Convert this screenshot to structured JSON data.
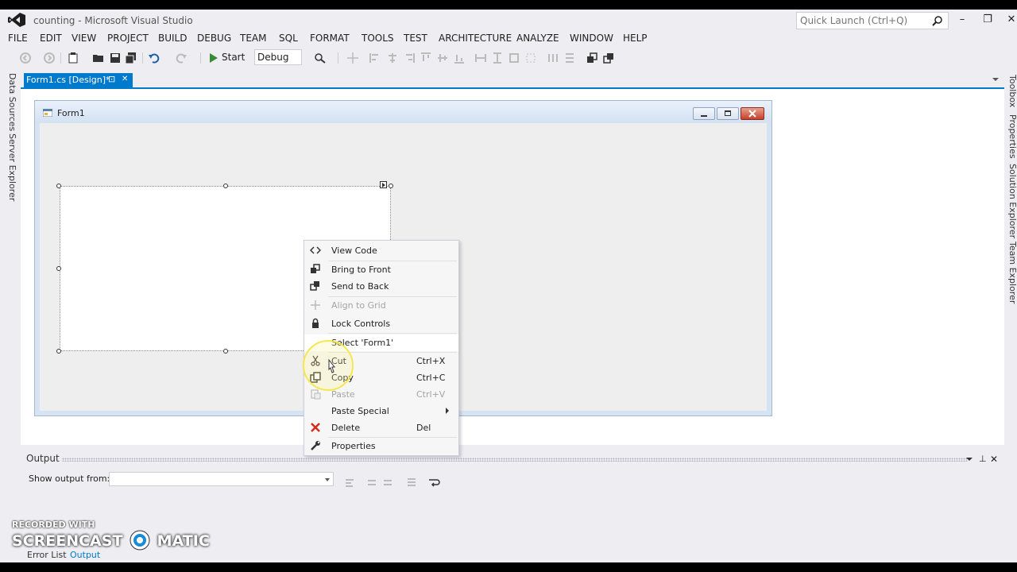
{
  "window": {
    "title": "counting - Microsoft Visual Studio",
    "quick_launch_placeholder": "Quick Launch (Ctrl+Q)",
    "minimize": "–",
    "restore": "❐",
    "close": "✕"
  },
  "menu": [
    "FILE",
    "EDIT",
    "VIEW",
    "PROJECT",
    "BUILD",
    "DEBUG",
    "TEAM",
    "SQL",
    "FORMAT",
    "TOOLS",
    "TEST",
    "ARCHITECTURE",
    "ANALYZE",
    "WINDOW",
    "HELP"
  ],
  "toolbar": {
    "start_label": "Start",
    "configuration": "Debug"
  },
  "left_panel": {
    "tabs": [
      "Data Sources",
      "Server Explorer"
    ]
  },
  "right_panel": {
    "tabs": [
      "Toolbox",
      "Properties",
      "Solution Explorer",
      "Team Explorer"
    ]
  },
  "document_tab": {
    "label": "Form1.cs [Design]*",
    "pin": "⊡",
    "close": "✕"
  },
  "form": {
    "title": "Form1"
  },
  "context_menu": [
    {
      "label": "View Code",
      "shortcut": "",
      "icon": "view-code-icon",
      "disabled": false
    },
    {
      "label": "Bring to Front",
      "shortcut": "",
      "icon": "bring-to-front-icon",
      "disabled": false
    },
    {
      "label": "Send to Back",
      "shortcut": "",
      "icon": "send-to-back-icon",
      "disabled": false
    },
    {
      "label": "Align to Grid",
      "shortcut": "",
      "icon": "align-to-grid-icon",
      "disabled": true
    },
    {
      "label": "Lock Controls",
      "shortcut": "",
      "icon": "lock-icon",
      "disabled": false
    },
    {
      "label": "Select 'Form1'",
      "shortcut": "",
      "icon": "",
      "disabled": false
    },
    {
      "label": "Cut",
      "shortcut": "Ctrl+X",
      "icon": "cut-icon",
      "disabled": false
    },
    {
      "label": "Copy",
      "shortcut": "Ctrl+C",
      "icon": "copy-icon",
      "disabled": false
    },
    {
      "label": "Paste",
      "shortcut": "Ctrl+V",
      "icon": "paste-icon",
      "disabled": true
    },
    {
      "label": "Paste Special",
      "shortcut": "",
      "icon": "",
      "disabled": false
    },
    {
      "label": "Delete",
      "shortcut": "Del",
      "icon": "delete-icon",
      "disabled": false
    },
    {
      "label": "Properties",
      "shortcut": "",
      "icon": "wrench-icon",
      "disabled": false
    }
  ],
  "output": {
    "title": "Output",
    "show_from_label": "Show output from:",
    "show_from_value": ""
  },
  "bottom_tabs": [
    "Error List",
    "Output"
  ],
  "watermark": {
    "line1": "RECORDED WITH",
    "line2a": "SCREENCAST",
    "line2b": "MATIC"
  },
  "colors": {
    "accent": "#007acc",
    "delete_red": "#d42b1e"
  }
}
